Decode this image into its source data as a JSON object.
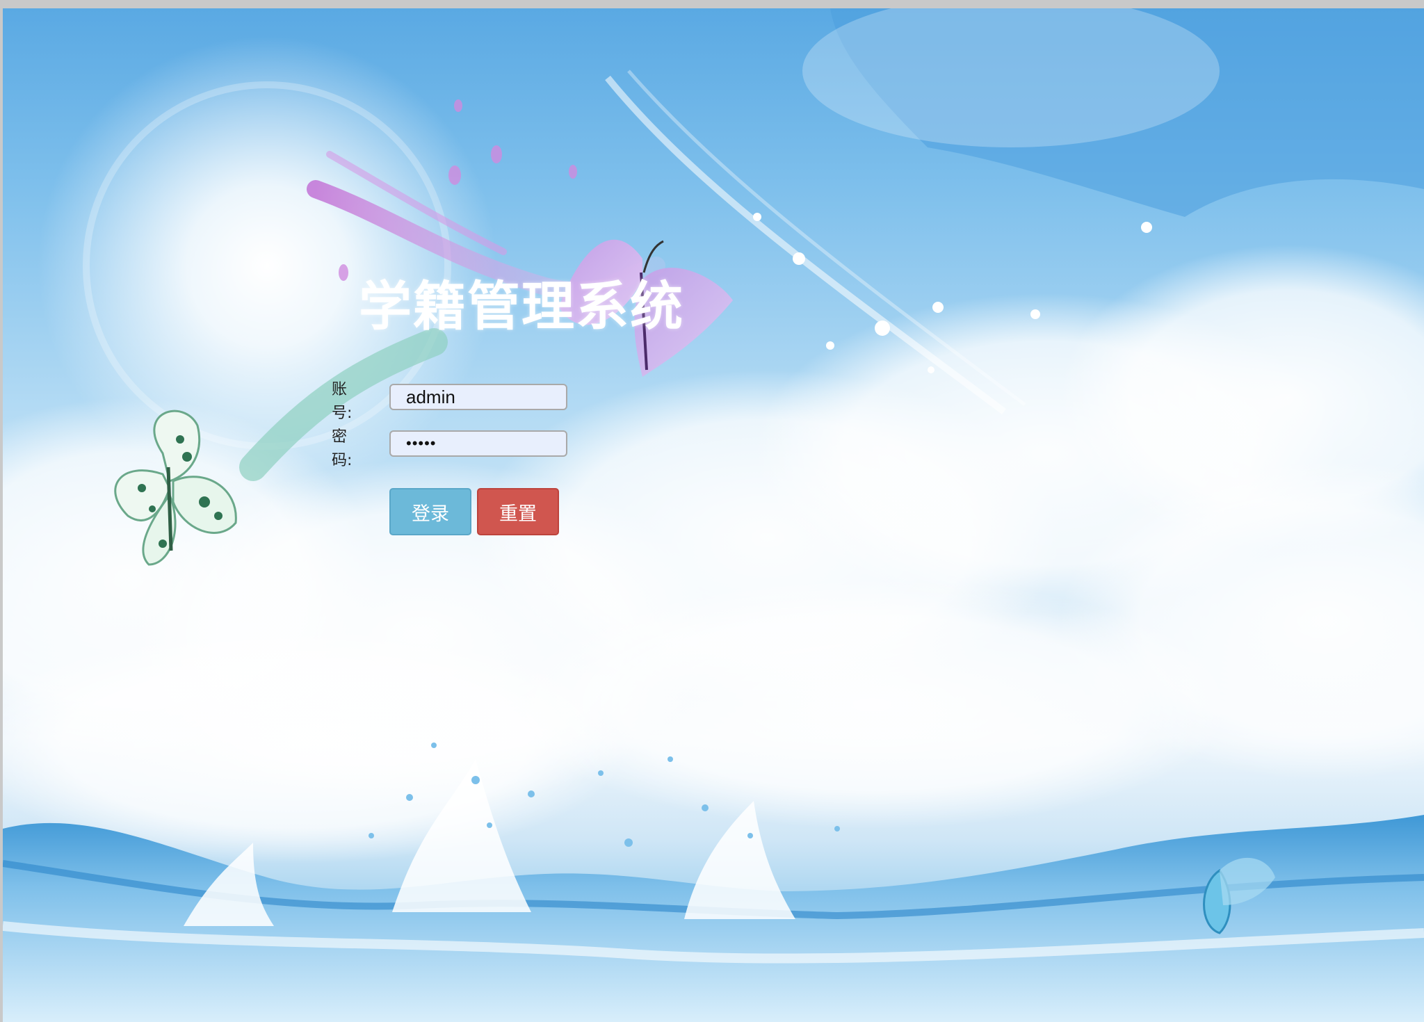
{
  "login": {
    "title": "学籍管理系统",
    "account_label": "账号:",
    "password_label": "密码:",
    "account_value": "admin",
    "password_value": "•••••",
    "login_button": "登录",
    "reset_button": "重置"
  },
  "colors": {
    "login_button": "#6cb9d9",
    "reset_button": "#d0564f",
    "input_background": "#e8effd",
    "title_text": "#ffffff"
  },
  "icons": {
    "background": "sky-clouds-water-splash-butterflies"
  }
}
